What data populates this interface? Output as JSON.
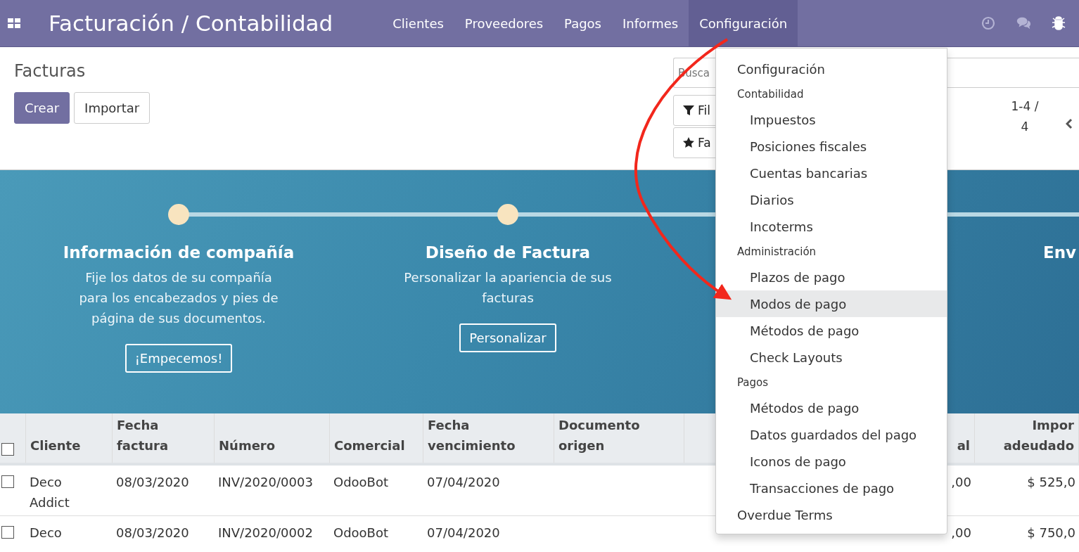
{
  "navbar": {
    "brand": "Facturación / Contabilidad",
    "menu": [
      {
        "label": "Clientes",
        "selected": false
      },
      {
        "label": "Proveedores",
        "selected": false
      },
      {
        "label": "Pagos",
        "selected": false
      },
      {
        "label": "Informes",
        "selected": false
      },
      {
        "label": "Configuración",
        "selected": true
      }
    ]
  },
  "control_panel": {
    "breadcrumb": "Facturas",
    "buttons": [
      "Crear",
      "Importar"
    ],
    "search": {
      "placeholder": "Busca"
    },
    "filter_buttons": [
      "Fil",
      "Fa"
    ],
    "pager": "1-4 / 4"
  },
  "banner": {
    "steps": [
      {
        "title": "Información de compañía",
        "description": "Fije los datos de su compañía para los encabezados y pies de página de sus documentos.",
        "button": "¡Empecemos!"
      },
      {
        "title": "Diseño de Factura",
        "description": "Personalizar la apariencia de sus facturas",
        "button": "Personalizar"
      },
      {
        "title": "Env"
      }
    ]
  },
  "table": {
    "all_checked": false,
    "columns": [
      "Cliente",
      "Fecha factura",
      "Número",
      "Comercial",
      "Fecha vencimiento",
      "Documento origen",
      "al",
      "Impor adeudado"
    ],
    "rows": [
      {
        "checked": false,
        "cells": [
          "Deco Addict",
          "08/03/2020",
          "INV/2020/0003",
          "OdooBot",
          "07/04/2020",
          null,
          ",00",
          "$ 525,0"
        ]
      },
      {
        "checked": false,
        "cells": [
          "Deco",
          "08/03/2020",
          "INV/2020/0002",
          "OdooBot",
          "07/04/2020",
          null,
          ",00",
          "$ 750,0"
        ]
      }
    ]
  },
  "dropdown": {
    "entries": [
      {
        "kind": "item",
        "label": "Configuración",
        "selected": false
      },
      {
        "kind": "section",
        "label": "Contabilidad",
        "children": [
          {
            "label": "Impuestos",
            "selected": false
          },
          {
            "label": "Posiciones fiscales",
            "selected": false
          },
          {
            "label": "Cuentas bancarias",
            "selected": false
          },
          {
            "label": "Diarios",
            "selected": false
          },
          {
            "label": "Incoterms",
            "selected": false
          }
        ]
      },
      {
        "kind": "section",
        "label": "Administración",
        "children": [
          {
            "label": "Plazos de pago",
            "selected": false
          },
          {
            "label": "Modos de pago",
            "selected": true
          },
          {
            "label": "Métodos de pago",
            "selected": false
          },
          {
            "label": "Check Layouts",
            "selected": false
          }
        ]
      },
      {
        "kind": "section",
        "label": "Pagos",
        "children": [
          {
            "label": "Métodos de pago",
            "selected": false
          },
          {
            "label": "Datos guardados del pago",
            "selected": false
          },
          {
            "label": "Iconos de pago",
            "selected": false
          },
          {
            "label": "Transacciones de pago",
            "selected": false
          }
        ]
      },
      {
        "kind": "item",
        "label": "Overdue Terms",
        "selected": false
      }
    ]
  }
}
